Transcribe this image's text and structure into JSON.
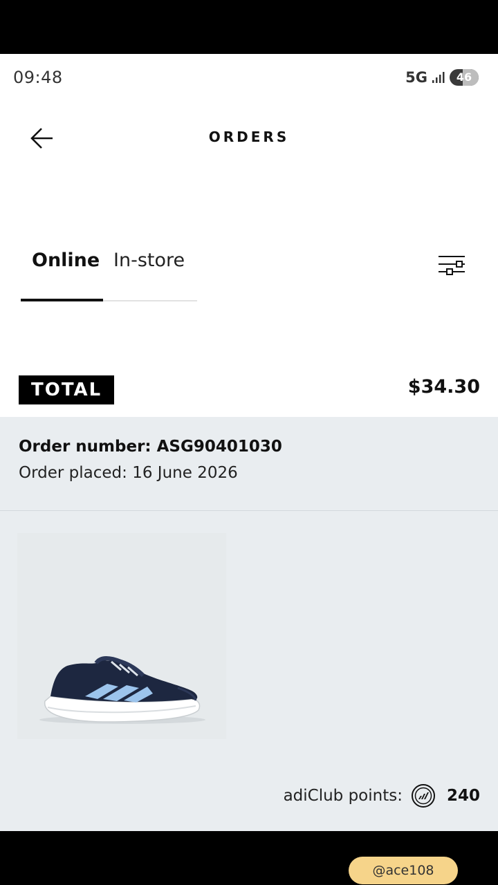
{
  "status_bar": {
    "time": "09:48",
    "network": "5G",
    "battery": "46",
    "battery_level": 0.46
  },
  "header": {
    "title": "ORDERS",
    "back_icon": "arrow-left-icon"
  },
  "tabs": [
    {
      "label": "Online",
      "active": true
    },
    {
      "label": "In-store",
      "active": false
    }
  ],
  "filter_icon": "filter-sliders-icon",
  "total": {
    "label": "TOTAL",
    "value": "$34.30"
  },
  "order": {
    "number_line": "Order number: ASG90401030",
    "placed_line": "Order placed: 16 June 2026",
    "product_image": "navy running shoe with light blue stripes",
    "points_label": "adiClub points:",
    "points_icon": "adiclub-points-icon",
    "points_value": "240"
  },
  "watermark": "@ace108",
  "colors": {
    "accent": "#000000",
    "panel_bg": "#e9edf0",
    "shoe_body": "#1d2740",
    "shoe_stripes": "#9cc4ec",
    "watermark_bg": "#f6d48a"
  }
}
